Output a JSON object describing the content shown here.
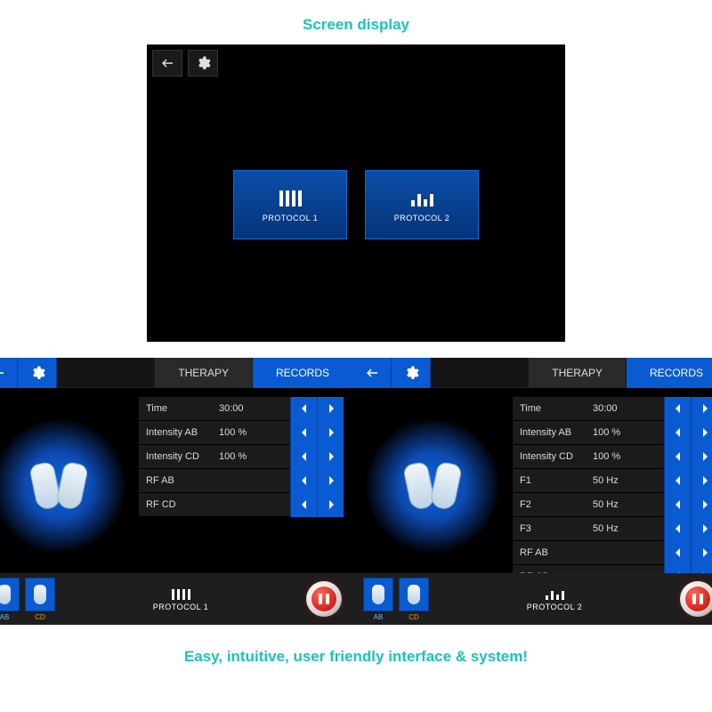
{
  "titles": {
    "top": "Screen display",
    "bottom": "Easy, intuitive, user friendly interface & system!"
  },
  "protocols": [
    {
      "label": "PROTOCOL 1",
      "bars": [
        18,
        18,
        18,
        18
      ]
    },
    {
      "label": "PROTOCOL 2",
      "bars": [
        7,
        14,
        8,
        14
      ]
    }
  ],
  "tabs": {
    "therapy": "THERAPY",
    "records": "RECORDS"
  },
  "footer_pads": {
    "ab": "AB",
    "cd": "CD"
  },
  "panel1": {
    "footer_label": "PROTOCOL 1",
    "footer_bars": [
      12,
      12,
      12,
      12
    ],
    "params": [
      {
        "label": "Time",
        "value": "30:00"
      },
      {
        "label": "Intensity AB",
        "value": "100 %"
      },
      {
        "label": "Intensity CD",
        "value": "100 %"
      },
      {
        "label": "RF AB",
        "value": ""
      },
      {
        "label": "RF CD",
        "value": ""
      }
    ]
  },
  "panel2": {
    "footer_label": "PROTOCOL 2",
    "footer_bars": [
      5,
      10,
      6,
      10
    ],
    "params": [
      {
        "label": "Time",
        "value": "30:00"
      },
      {
        "label": "Intensity AB",
        "value": "100 %"
      },
      {
        "label": "Intensity CD",
        "value": "100 %"
      },
      {
        "label": "F1",
        "value": "50 Hz"
      },
      {
        "label": "F2",
        "value": "50 Hz"
      },
      {
        "label": "F3",
        "value": "50 Hz"
      },
      {
        "label": "RF AB",
        "value": ""
      },
      {
        "label": "RF CD",
        "value": ""
      }
    ]
  }
}
